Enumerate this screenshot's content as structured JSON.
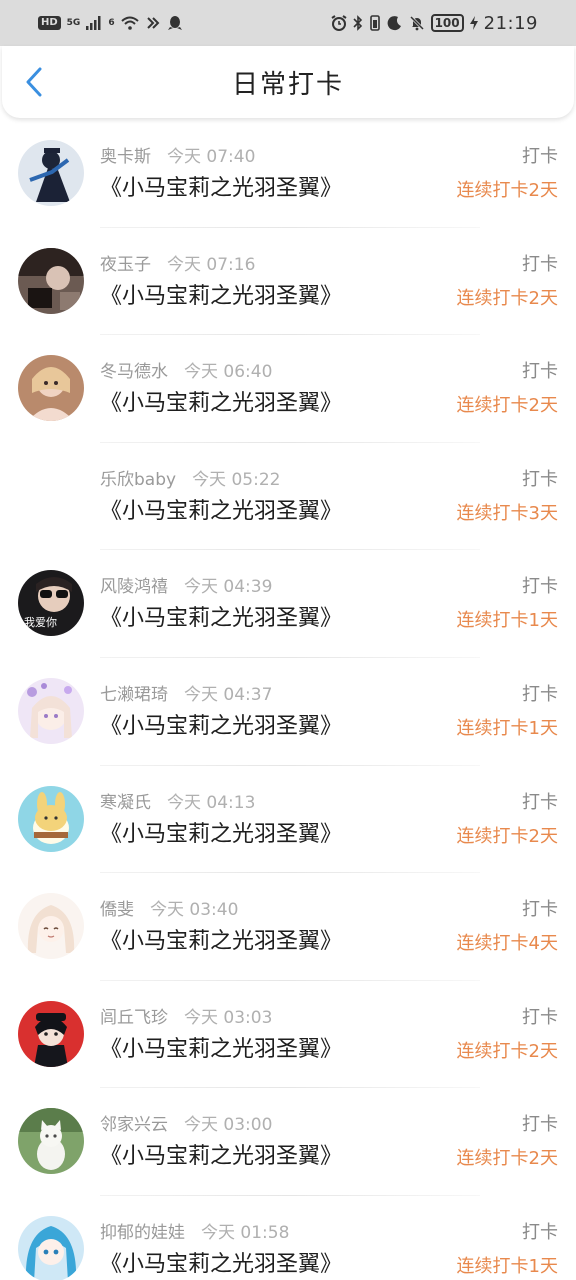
{
  "status_bar": {
    "left_badge": "HD",
    "network": "5G",
    "wifi_badge": "6",
    "battery": "100",
    "time": "21:19"
  },
  "header": {
    "title": "日常打卡",
    "back_icon": "chevron-left-icon"
  },
  "colors": {
    "accent": "#3a8fe0",
    "streak": "#e8894d"
  },
  "checkins": [
    {
      "name": "奥卡斯",
      "time": "今天 07:40",
      "book": "《小马宝莉之光羽圣翼》",
      "type": "打卡",
      "streak": "连续打卡2天",
      "avatar": "avatar-dark-figure"
    },
    {
      "name": "夜玉子",
      "time": "今天 07:16",
      "book": "《小马宝莉之光羽圣翼》",
      "type": "打卡",
      "streak": "连续打卡2天",
      "avatar": "avatar-photo"
    },
    {
      "name": "冬马德水",
      "time": "今天 06:40",
      "book": "《小马宝莉之光羽圣翼》",
      "type": "打卡",
      "streak": "连续打卡2天",
      "avatar": "avatar-portrait"
    },
    {
      "name": "乐欣baby",
      "time": "今天 05:22",
      "book": "《小马宝莉之光羽圣翼》",
      "type": "打卡",
      "streak": "连续打卡3天",
      "avatar": "none"
    },
    {
      "name": "风陵鸿禧",
      "time": "今天 04:39",
      "book": "《小马宝莉之光羽圣翼》",
      "type": "打卡",
      "streak": "连续打卡1天",
      "avatar": "avatar-sunglasses"
    },
    {
      "name": "七濑珺琦",
      "time": "今天 04:37",
      "book": "《小马宝莉之光羽圣翼》",
      "type": "打卡",
      "streak": "连续打卡1天",
      "avatar": "avatar-anime-purple"
    },
    {
      "name": "寒凝氏",
      "time": "今天 04:13",
      "book": "《小马宝莉之光羽圣翼》",
      "type": "打卡",
      "streak": "连续打卡2天",
      "avatar": "avatar-cartoon-bunny"
    },
    {
      "name": "僑斐",
      "time": "今天 03:40",
      "book": "《小马宝莉之光羽圣翼》",
      "type": "打卡",
      "streak": "连续打卡4天",
      "avatar": "avatar-anime-girl"
    },
    {
      "name": "闾丘飞珍",
      "time": "今天 03:03",
      "book": "《小马宝莉之光羽圣翼》",
      "type": "打卡",
      "streak": "连续打卡2天",
      "avatar": "avatar-anime-red"
    },
    {
      "name": "邻家兴云",
      "time": "今天 03:00",
      "book": "《小马宝莉之光羽圣翼》",
      "type": "打卡",
      "streak": "连续打卡2天",
      "avatar": "avatar-white-cat"
    },
    {
      "name": "抑郁的娃娃",
      "time": "今天 01:58",
      "book": "《小马宝莉之光羽圣翼》",
      "type": "打卡",
      "streak": "连续打卡1天",
      "avatar": "avatar-anime-blue"
    }
  ]
}
